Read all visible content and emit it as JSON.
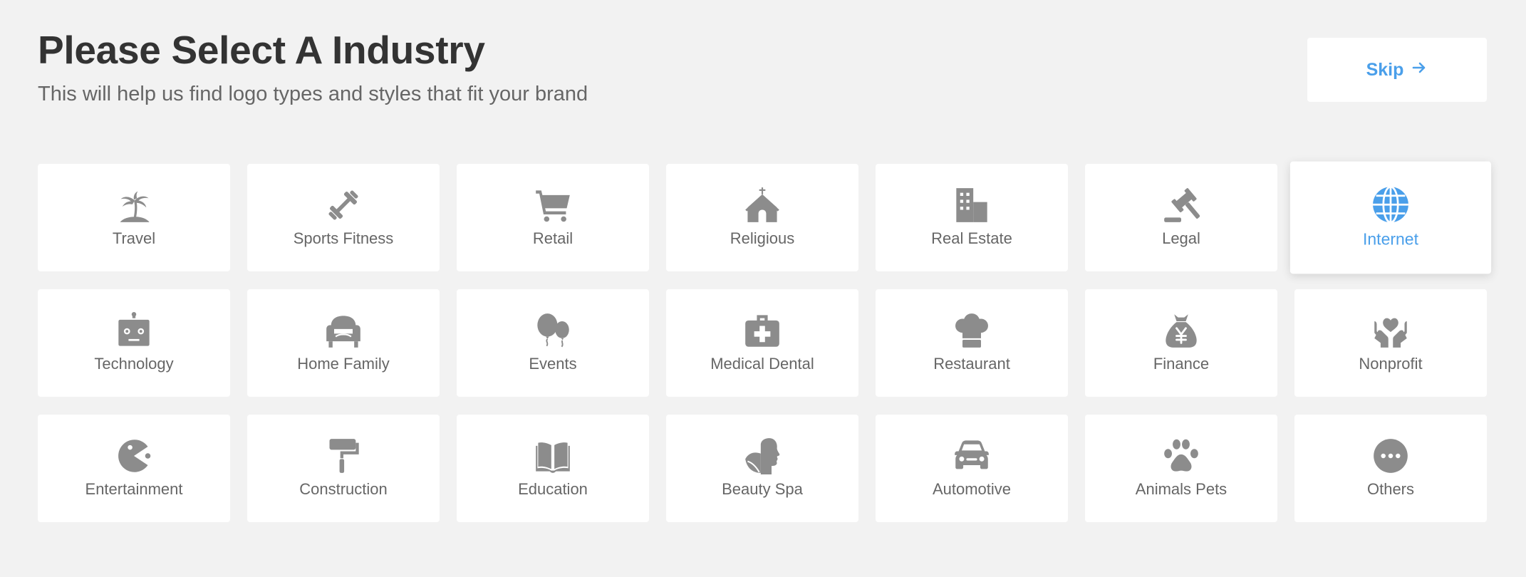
{
  "page": {
    "title": "Please Select A Industry",
    "subtitle": "This will help us find logo types and styles that fit your brand",
    "skip_label": "Skip"
  },
  "colors": {
    "accent": "#4a9fea",
    "icon": "#8c8c8c",
    "title": "#333333",
    "text": "#666666",
    "background": "#f2f2f2"
  },
  "industries": [
    {
      "label": "Travel",
      "icon": "palm-tree-icon"
    },
    {
      "label": "Sports Fitness",
      "icon": "dumbbell-icon"
    },
    {
      "label": "Retail",
      "icon": "shopping-cart-icon"
    },
    {
      "label": "Religious",
      "icon": "church-icon"
    },
    {
      "label": "Real Estate",
      "icon": "building-icon"
    },
    {
      "label": "Legal",
      "icon": "gavel-icon"
    },
    {
      "label": "Internet",
      "icon": "globe-icon",
      "selected": true
    },
    {
      "label": "Technology",
      "icon": "robot-icon"
    },
    {
      "label": "Home Family",
      "icon": "armchair-icon"
    },
    {
      "label": "Events",
      "icon": "balloons-icon"
    },
    {
      "label": "Medical Dental",
      "icon": "medical-kit-icon"
    },
    {
      "label": "Restaurant",
      "icon": "chef-hat-icon"
    },
    {
      "label": "Finance",
      "icon": "money-bag-icon"
    },
    {
      "label": "Nonprofit",
      "icon": "hands-heart-icon"
    },
    {
      "label": "Entertainment",
      "icon": "pacman-icon"
    },
    {
      "label": "Construction",
      "icon": "paint-roller-icon"
    },
    {
      "label": "Education",
      "icon": "open-book-icon"
    },
    {
      "label": "Beauty Spa",
      "icon": "leaf-head-icon"
    },
    {
      "label": "Automotive",
      "icon": "car-icon"
    },
    {
      "label": "Animals Pets",
      "icon": "paw-icon"
    },
    {
      "label": "Others",
      "icon": "more-dots-icon"
    }
  ]
}
